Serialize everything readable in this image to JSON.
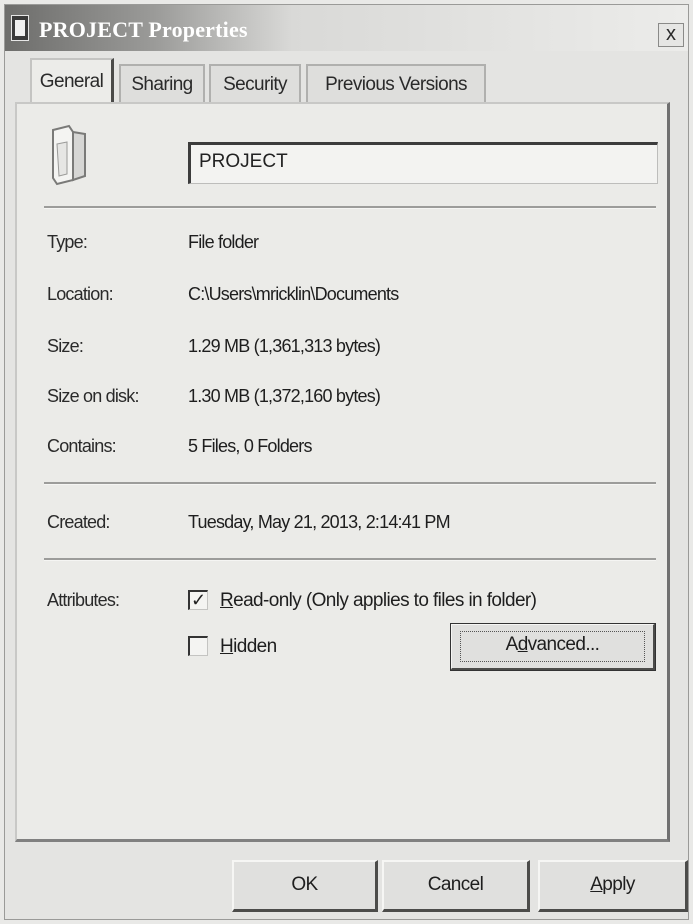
{
  "window": {
    "title": "PROJECT Properties",
    "close_glyph": "x",
    "icon": "folder-icon"
  },
  "tabs": [
    {
      "label": "General",
      "active": true
    },
    {
      "label": "Sharing",
      "active": false
    },
    {
      "label": "Security",
      "active": false
    },
    {
      "label": "Previous Versions",
      "active": false
    }
  ],
  "general": {
    "folder_icon": "folder-icon",
    "name_value": "PROJECT",
    "properties": [
      {
        "label": "Type:",
        "value": "File folder"
      },
      {
        "label": "Location:",
        "value": "C:\\Users\\mricklin\\Documents"
      },
      {
        "label": "Size:",
        "value": "1.29 MB (1,361,313 bytes)"
      },
      {
        "label": "Size on disk:",
        "value": "1.30 MB (1,372,160 bytes)"
      },
      {
        "label": "Contains:",
        "value": "5 Files, 0 Folders"
      }
    ],
    "created_label": "Created:",
    "created_value": "Tuesday, May 21, 2013, 2:14:41 PM",
    "attributes_label": "Attributes:",
    "readonly": {
      "checked": true,
      "check_glyph": "✓",
      "access_key": "R",
      "label_rest": "ead-only (Only applies to files in folder)"
    },
    "hidden": {
      "checked": false,
      "access_key": "H",
      "label_rest": "idden"
    },
    "advanced_button": {
      "before": "A",
      "access_key": "d",
      "after": "vanced..."
    }
  },
  "footer": {
    "ok": "OK",
    "cancel": "Cancel",
    "apply": {
      "access_key": "A",
      "label_rest": "pply"
    }
  }
}
